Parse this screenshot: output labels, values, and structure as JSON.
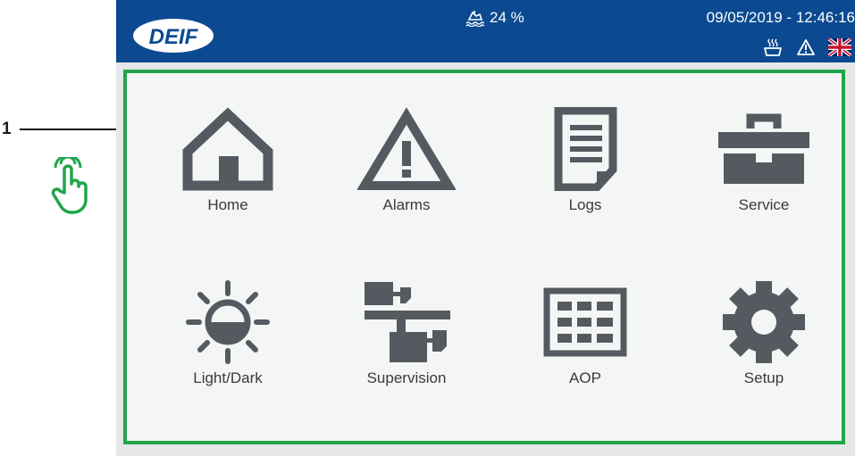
{
  "callout": {
    "number": "1"
  },
  "header": {
    "logo_text": "DEIF",
    "fuel_level": "24 %",
    "datetime": "09/05/2019 - 12:46:16"
  },
  "menu": {
    "items": [
      {
        "label": "Home",
        "icon": "house-icon"
      },
      {
        "label": "Alarms",
        "icon": "warning-triangle-icon"
      },
      {
        "label": "Logs",
        "icon": "document-icon"
      },
      {
        "label": "Service",
        "icon": "toolbox-icon"
      },
      {
        "label": "Light/Dark",
        "icon": "sun-half-icon"
      },
      {
        "label": "Supervision",
        "icon": "network-icon"
      },
      {
        "label": "AOP",
        "icon": "keypad-grid-icon"
      },
      {
        "label": "Setup",
        "icon": "gear-icon"
      }
    ]
  },
  "colors": {
    "header_bg": "#0b4a91",
    "panel_border": "#1fa64a",
    "icon_gray": "#555a60"
  }
}
